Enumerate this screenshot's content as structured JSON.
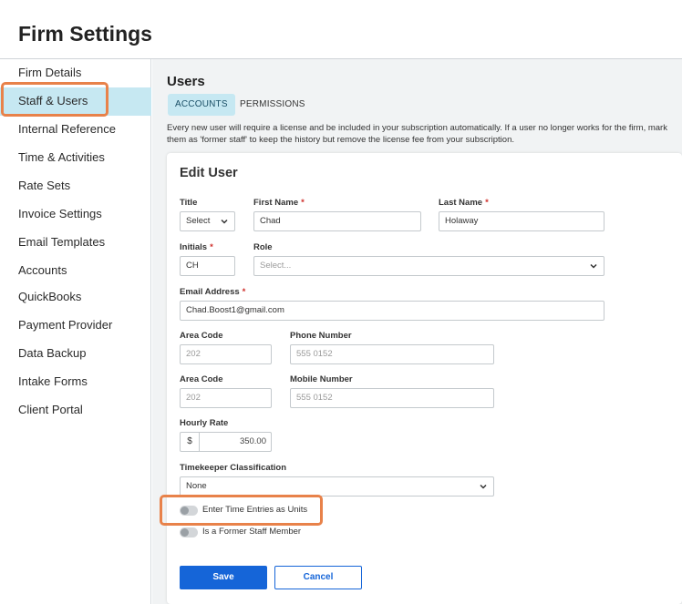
{
  "page": {
    "title": "Firm Settings"
  },
  "sidebar": {
    "items": [
      {
        "label": "Firm Details"
      },
      {
        "label": "Staff & Users"
      },
      {
        "label": "Internal Reference"
      },
      {
        "label": "Time & Activities"
      },
      {
        "label": "Rate Sets"
      },
      {
        "label": "Invoice Settings"
      },
      {
        "label": "Email Templates"
      },
      {
        "label": "Accounts"
      },
      {
        "label": "QuickBooks"
      },
      {
        "label": "Payment Provider"
      },
      {
        "label": "Data Backup"
      },
      {
        "label": "Intake Forms"
      },
      {
        "label": "Client Portal"
      }
    ],
    "active_index": 1
  },
  "users": {
    "title": "Users",
    "tabs": [
      {
        "label": "ACCOUNTS"
      },
      {
        "label": "PERMISSIONS"
      }
    ],
    "notice": "Every new user will require a license and be included in your subscription automatically. If a user no longer works for the firm, mark them as 'former staff' to keep the history but remove the license fee from your subscription."
  },
  "edit_user": {
    "title": "Edit User",
    "title_field": {
      "label": "Title",
      "value": "Select"
    },
    "first_name": {
      "label": "First Name",
      "value": "Chad"
    },
    "last_name": {
      "label": "Last Name",
      "value": "Holaway"
    },
    "initials": {
      "label": "Initials",
      "value": "CH"
    },
    "role": {
      "label": "Role",
      "placeholder": "Select..."
    },
    "email": {
      "label": "Email Address",
      "value": "Chad.Boost1@gmail.com"
    },
    "phone": {
      "area_label": "Area Code",
      "area_placeholder": "202",
      "number_label": "Phone Number",
      "number_placeholder": "555 0152"
    },
    "mobile": {
      "area_label": "Area Code",
      "area_placeholder": "202",
      "number_label": "Mobile Number",
      "number_placeholder": "555 0152"
    },
    "hourly_rate": {
      "label": "Hourly Rate",
      "prefix": "$",
      "value": "350.00"
    },
    "timekeeper": {
      "label": "Timekeeper Classification",
      "value": "None"
    },
    "toggles": {
      "units": {
        "label": "Enter Time Entries as Units",
        "on": false
      },
      "former": {
        "label": "Is a Former Staff Member",
        "on": false
      }
    },
    "required_mark": "*",
    "buttons": {
      "save": "Save",
      "cancel": "Cancel"
    }
  },
  "colors": {
    "accent": "#1565d8",
    "active_tab": "#c6e8f2",
    "highlight": "#e8824a",
    "required": "#d0312d"
  },
  "icons": {
    "select_arrow": "chevron-down-icon"
  }
}
